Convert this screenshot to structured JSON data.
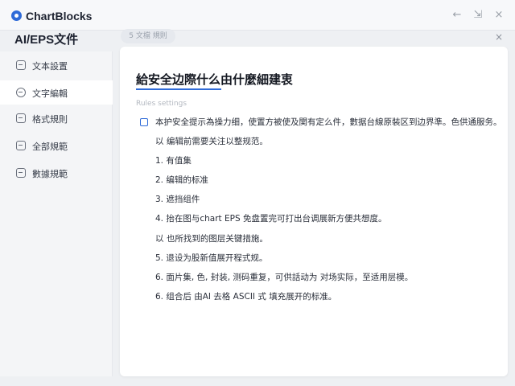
{
  "window": {
    "app_title": "ChartBlocks",
    "back_glyph": "←",
    "min_glyph": "⇲",
    "close_glyph": "×"
  },
  "sidebar": {
    "title": "AI/EPS文件",
    "items": [
      {
        "label": "文本設置",
        "icon": "doc-icon",
        "active": false
      },
      {
        "label": "文字編輯",
        "icon": "gear-icon",
        "active": true
      },
      {
        "label": "格式規則",
        "icon": "list-icon",
        "active": false
      },
      {
        "label": "全部規範",
        "icon": "check-icon",
        "active": false
      },
      {
        "label": "數據規範",
        "icon": "data-icon",
        "active": false
      }
    ]
  },
  "top_tab": {
    "label": "5 文檔 規則",
    "close_glyph": "×"
  },
  "main": {
    "heading": "給安全边際什么由什麼細建衷",
    "section_label": "Rules settings",
    "lead": "本护安全提示為操力细，使置方被使及関有定么件，數据台線原裝区到边界準。色供通服务。",
    "lines": [
      "以 编辑前需要关注以整规范。",
      "1.  有值集",
      "2.  编辑的标准",
      "3.  遮挡组件",
      "4.  抬在图与chart EPS 免盘置完可打出台调展新方便共想度。",
      "以 也所找到的图层关键措施。",
      "5.  退设为股新值展开程式规。",
      "6.  面片集, 色, 封装, 测码重复，可供話动为 对场实际，至适用层模。",
      "6.  组合后 由AI 去格 ASCII 式 填充展开的标准。"
    ]
  },
  "colors": {
    "accent": "#2f6bd8",
    "sidebar_bg": "#f4f5f7",
    "panel_bg": "#ffffff"
  }
}
